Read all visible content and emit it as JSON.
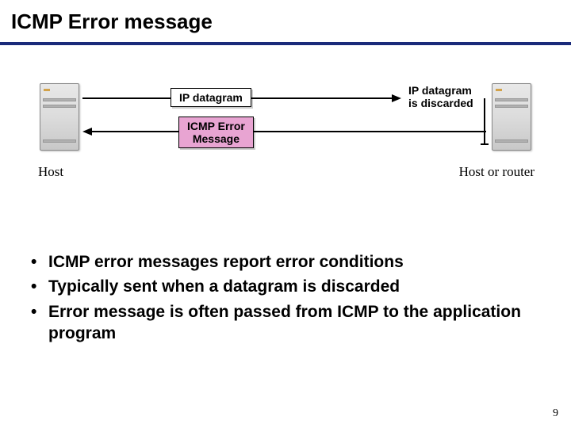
{
  "title": "ICMP Error message",
  "diagram": {
    "datagram_label": "IP datagram",
    "error_label_line1": "ICMP Error",
    "error_label_line2": "Message",
    "discarded_line1": "IP datagram",
    "discarded_line2": "is discarded",
    "host_left": "Host",
    "host_right": "Host or router"
  },
  "bullets": [
    "ICMP error messages report error conditions",
    "Typically sent when a datagram is discarded",
    "Error message is often passed from ICMP to the application program"
  ],
  "page_number": "9"
}
